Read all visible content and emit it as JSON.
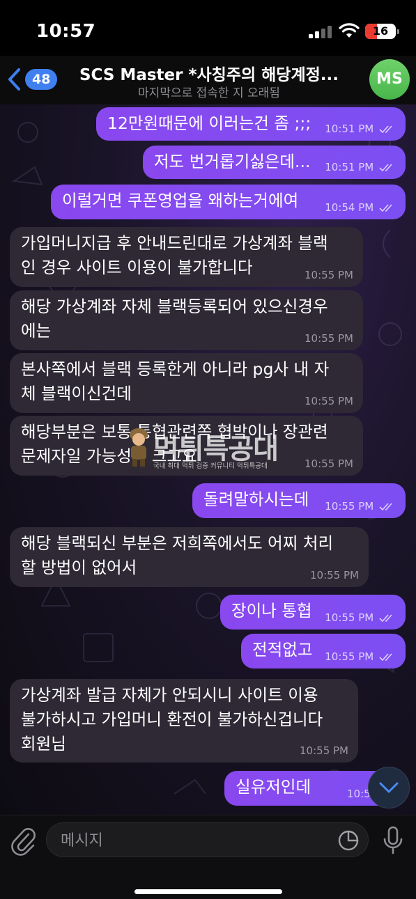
{
  "status_bar": {
    "time": "10:57",
    "battery": "16"
  },
  "header": {
    "back_count": "48",
    "title": "SCS Master *사칭주의 해당계정...",
    "subtitle": "마지막으로 접속한 지 오래됨",
    "avatar_initials": "MS"
  },
  "messages": [
    {
      "text": "12만원때문에 이러는건 좀 ;;;",
      "time": "10:51 PM"
    },
    {
      "text": "저도 번거롭기싫은데...",
      "time": "10:51 PM"
    },
    {
      "text": "이럴거면 쿠폰영업을 왜하는거에여",
      "time": "10:54 PM"
    },
    {
      "line1": "가입머니지급 후 안내드린대로 가상계좌 블랙",
      "line2": "인 경우 사이트 이용이 불가합니다",
      "time": "10:55 PM"
    },
    {
      "line1": "해당 가상계좌 자체 블랙등록되어 있으신경우",
      "line2": "에는",
      "time": "10:55 PM"
    },
    {
      "line1": "본사쪽에서 블랙 등록한게 아니라 pg사 내 자",
      "line2": "체 블랙이신건데",
      "time": "10:55 PM"
    },
    {
      "line1": "해당부분은 보통 통협관련쪽 협박이나 장관련",
      "line2": "문제자일 가능성이 크고요",
      "time": "10:55 PM"
    },
    {
      "text": "돌려말하시는데",
      "time": "10:55 PM"
    },
    {
      "line1": "해당 블랙되신 부분은 저희쪽에서도 어찌 처리",
      "line2": "할 방법이 없어서",
      "time": "10:55 PM"
    },
    {
      "text": "장이나 통협",
      "time": "10:55 PM"
    },
    {
      "text": "전적없고",
      "time": "10:55 PM"
    },
    {
      "line1": "가상계좌 발급 자체가 안되시니 사이트 이용",
      "line2": "불가하시고 가입머니 환전이 불가하신겁니다",
      "line3": "회원님",
      "time": "10:55 PM"
    },
    {
      "text": "실유저인데",
      "time": "10:55 PM"
    }
  ],
  "watermark": {
    "text": "먹튀특공대",
    "subtext": "국내 최대 먹튀 검증 커뮤니티 먹튀특공대"
  },
  "input": {
    "placeholder": "메시지"
  },
  "icons": {
    "back": "chevron-left-icon",
    "attach": "paperclip-icon",
    "sticker": "sticker-icon",
    "mic": "microphone-icon",
    "scroll": "chevron-down-icon",
    "read": "double-check-icon"
  },
  "colors": {
    "outgoing": "#8a48ef",
    "incoming": "#2e2935",
    "accent": "#3f7ff0",
    "avatar": "#5bc45a"
  }
}
